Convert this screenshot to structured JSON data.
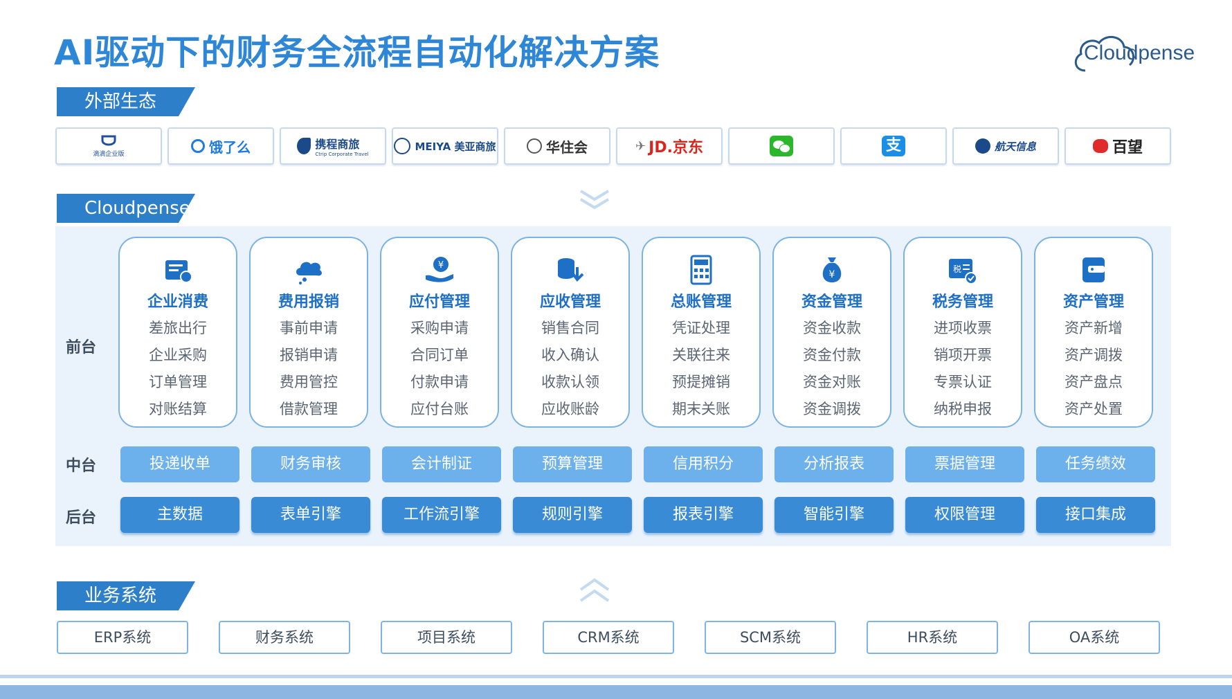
{
  "title": "AI驱动下的财务全流程自动化解决方案",
  "brand": {
    "logo_text": "Cloudpense",
    "color": "#2e86d6"
  },
  "sections": {
    "external": "外部生态",
    "cloudpense": "Cloudpense",
    "business": "业务系统"
  },
  "ecosystem": [
    {
      "icon": "didi-logo-icon",
      "text": "",
      "sub": "滴滴企业版",
      "color": "#1f4fa0"
    },
    {
      "icon": "eleme-logo-icon",
      "text": "饿了么",
      "color": "#1e7be0"
    },
    {
      "icon": "ctrip-logo-icon",
      "text": "携程商旅",
      "sub": "Ctrip Corporate Travel",
      "color": "#1b4a8a"
    },
    {
      "icon": "meiya-logo-icon",
      "text": "MEIYA 美亚商旅",
      "color": "#1b4a8a"
    },
    {
      "icon": "huazhuhui-logo-icon",
      "text": "华住会",
      "color": "#333333"
    },
    {
      "icon": "jd-logo-icon",
      "text": "JD.京东",
      "color": "#d9251c"
    },
    {
      "icon": "wechat-icon",
      "text": "",
      "color": "#2bb62b"
    },
    {
      "icon": "alipay-icon",
      "text": "",
      "color": "#1b8fe6"
    },
    {
      "icon": "hangtian-logo-icon",
      "text": "航天信息",
      "color": "#1b4a8a"
    },
    {
      "icon": "baiwang-logo-icon",
      "text": "百望",
      "color": "#e12b2b"
    }
  ],
  "rows": {
    "front": "前台",
    "middle": "中台",
    "back": "后台"
  },
  "modules": [
    {
      "icon": "card-icon",
      "title": "企业消费",
      "items": [
        "差旅出行",
        "企业采购",
        "订单管理",
        "对账结算"
      ]
    },
    {
      "icon": "cloud-icon",
      "title": "费用报销",
      "items": [
        "事前申请",
        "报销申请",
        "费用管控",
        "借款管理"
      ]
    },
    {
      "icon": "yuan-hand-icon",
      "title": "应付管理",
      "items": [
        "采购申请",
        "合同订单",
        "付款申请",
        "应付台账"
      ]
    },
    {
      "icon": "coins-icon",
      "title": "应收管理",
      "items": [
        "销售合同",
        "收入确认",
        "收款认领",
        "应收账龄"
      ]
    },
    {
      "icon": "calculator-icon",
      "title": "总账管理",
      "items": [
        "凭证处理",
        "关联往来",
        "预提摊销",
        "期末关账"
      ]
    },
    {
      "icon": "money-bag-icon",
      "title": "资金管理",
      "items": [
        "资金收款",
        "资金付款",
        "资金对账",
        "资金调拨"
      ]
    },
    {
      "icon": "tax-icon",
      "title": "税务管理",
      "items": [
        "进项收票",
        "销项开票",
        "专票认证",
        "纳税申报"
      ]
    },
    {
      "icon": "wallet-icon",
      "title": "资产管理",
      "items": [
        "资产新增",
        "资产调拨",
        "资产盘点",
        "资产处置"
      ]
    }
  ],
  "middle": [
    "投递收单",
    "财务审核",
    "会计制证",
    "预算管理",
    "信用积分",
    "分析报表",
    "票据管理",
    "任务绩效"
  ],
  "back": [
    "主数据",
    "表单引擎",
    "工作流引擎",
    "规则引擎",
    "报表引擎",
    "智能引擎",
    "权限管理",
    "接口集成"
  ],
  "systems": [
    "ERP系统",
    "财务系统",
    "项目系统",
    "CRM系统",
    "SCM系统",
    "HR系统",
    "OA系统"
  ]
}
